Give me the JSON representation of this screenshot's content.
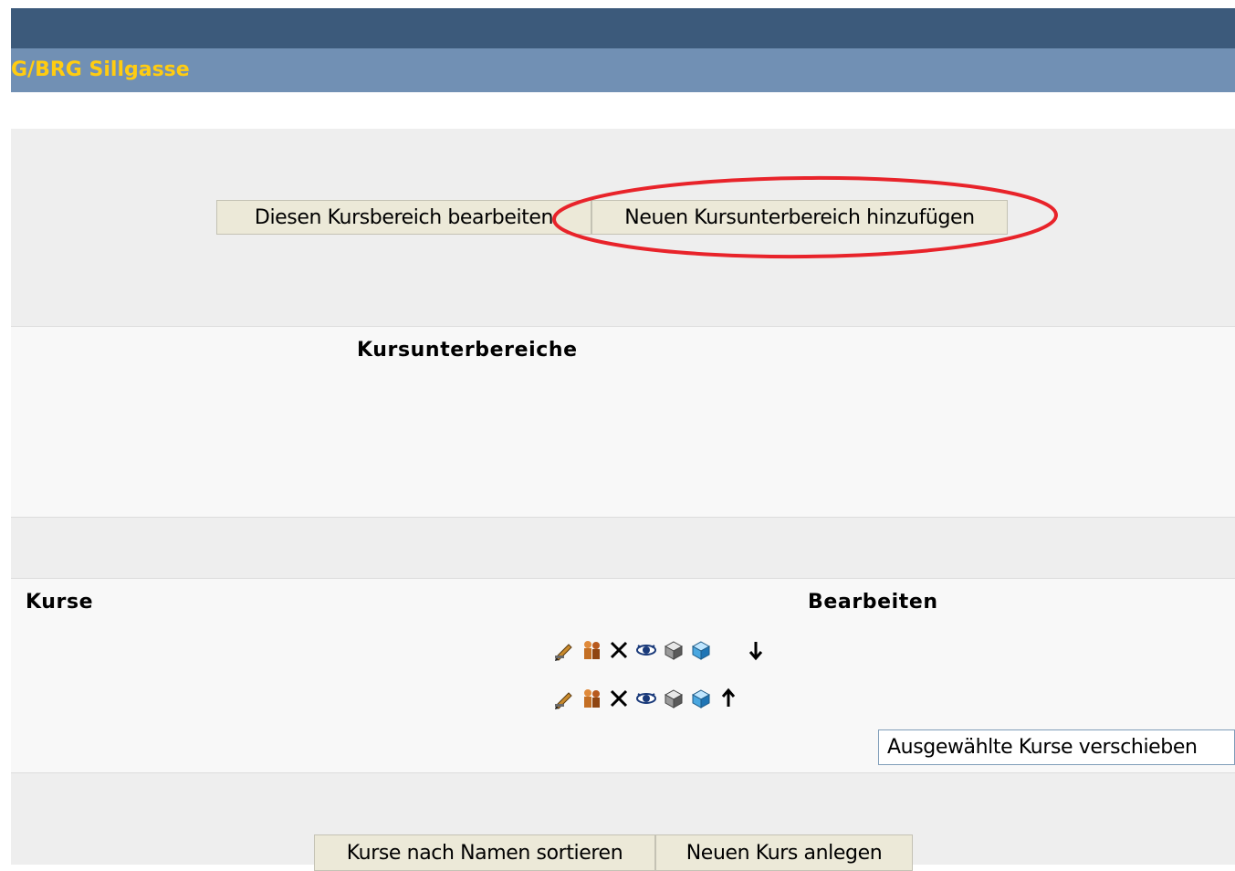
{
  "header": {
    "site_title": "G/BRG Sillgasse"
  },
  "category_actions": {
    "edit_category_label": "Diesen Kursbereich bearbeiten",
    "add_subcategory_label": "Neuen Kursunterbereich hinzufügen",
    "highlight_color": "#e8232a"
  },
  "subcategories": {
    "heading": "Kursunterbereiche"
  },
  "courses": {
    "column_courses": "Kurse",
    "column_edit": "Bearbeiten",
    "rows": [
      {
        "icons": [
          "edit-icon",
          "roles-icon",
          "delete-icon",
          "show-icon",
          "backup-icon",
          "restore-icon",
          "move-down-icon"
        ]
      },
      {
        "icons": [
          "edit-icon",
          "roles-icon",
          "delete-icon",
          "show-icon",
          "backup-icon",
          "restore-icon",
          "move-up-icon"
        ]
      }
    ],
    "move_selected_label": "Ausgewählte Kurse verschieben"
  },
  "footer_actions": {
    "sort_by_name_label": "Kurse nach Namen sortieren",
    "new_course_label": "Neuen Kurs anlegen"
  }
}
